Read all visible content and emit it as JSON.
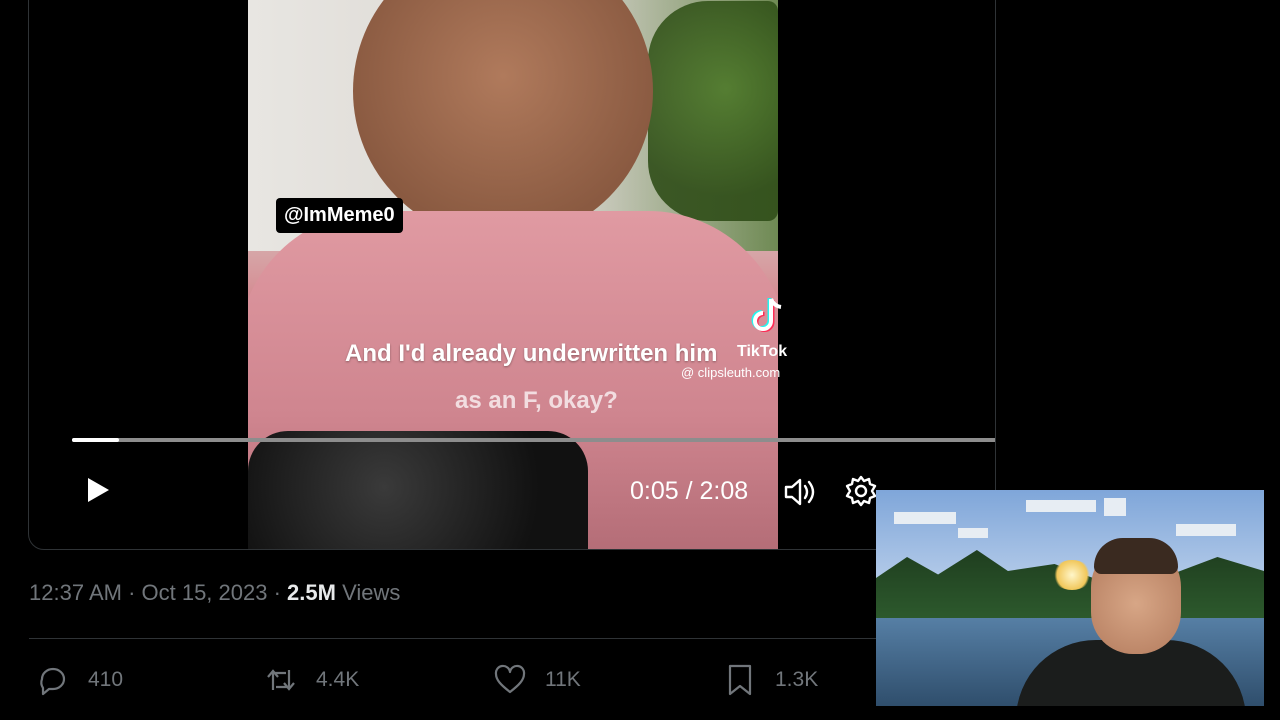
{
  "video": {
    "handle": "@ImMeme0",
    "caption_line1": "And I'd already underwritten him",
    "caption_line2": "as an F, okay?",
    "watermark_label": "TikTok",
    "watermark_credit": "@ clipsleuth.com",
    "progress_fraction": 0.05,
    "time_display": "0:05 / 2:08",
    "icons": {
      "play": "play-icon",
      "volume": "volume-icon",
      "settings": "settings-gear-icon",
      "tiktok": "tiktok-logo-icon"
    }
  },
  "tweet_meta": {
    "timestamp": "12:37 AM · Oct 15, 2023 · ",
    "views_count": "2.5M",
    "views_label": " Views"
  },
  "actions": {
    "replies": "410",
    "reposts": "4.4K",
    "likes": "11K",
    "bookmarks": "1.3K",
    "icons": [
      "reply-icon",
      "repost-icon",
      "like-icon",
      "bookmark-icon"
    ]
  },
  "colors": {
    "background": "#000000",
    "text_secondary": "#71767b",
    "text_primary": "#e7e9ea",
    "divider": "#2f3336"
  }
}
